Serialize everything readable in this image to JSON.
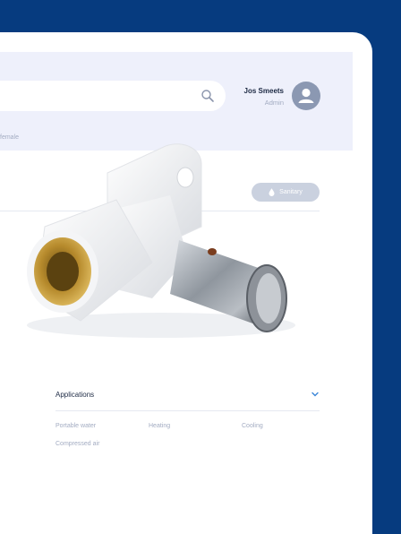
{
  "user": {
    "name": "Jos Smeets",
    "role": "Admin"
  },
  "breadcrumb": {
    "fragment": "female"
  },
  "badge": {
    "label": "Sanitary"
  },
  "applications": {
    "title": "Applications",
    "items": [
      "Portable water",
      "Heating",
      "Cooling",
      "Compressed air"
    ]
  }
}
